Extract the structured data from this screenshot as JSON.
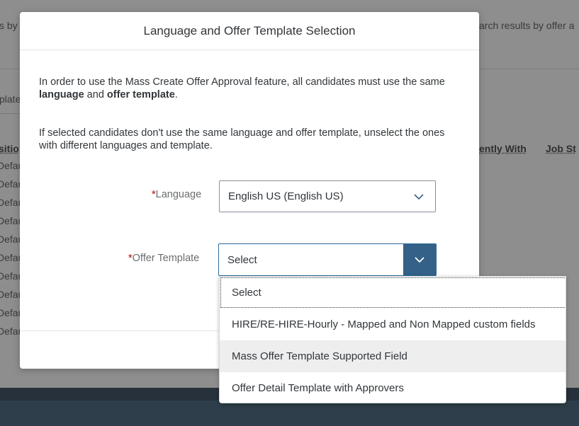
{
  "background": {
    "left_snippet": "s by",
    "right_snippet": "arch results by offer a",
    "template_snippet": "plate",
    "col_position": "sitio",
    "col_currently_with": "ently With",
    "col_job_status": "Job St",
    "row_values": [
      "Defau",
      "Defau",
      "Defau",
      "Defau",
      "Defau",
      "Defau",
      "Defau",
      "Defau",
      "Defau",
      "Defau"
    ]
  },
  "dialog": {
    "title": "Language and Offer Template Selection",
    "para1_prefix": "In order to use the Mass Create Offer Approval feature, all candidates must use the same ",
    "para1_bold1": "language",
    "para1_mid": " and ",
    "para1_bold2": "offer template",
    "para1_suffix": ".",
    "para2": "If selected candidates don't use the same language and offer template, unselect the ones with different languages and template.",
    "required_mark": "*",
    "language_label": "Language",
    "language_value": "English US (English US)",
    "offer_template_label": "Offer Template",
    "offer_template_value": "Select"
  },
  "dropdown": {
    "options": [
      "Select",
      "HIRE/RE-HIRE-Hourly - Mapped and Non Mapped custom fields",
      "Mass Offer Template Supported Field",
      "Offer Detail Template with Approvers"
    ],
    "focused_index": 0,
    "hover_index": 2
  },
  "colors": {
    "required": "#bb0000",
    "active_arrow_bg": "#346187",
    "footer_dark": "#26313b"
  },
  "icons": {
    "language_arrow": "chevron-down-icon",
    "offer_arrow": "chevron-down-icon"
  }
}
